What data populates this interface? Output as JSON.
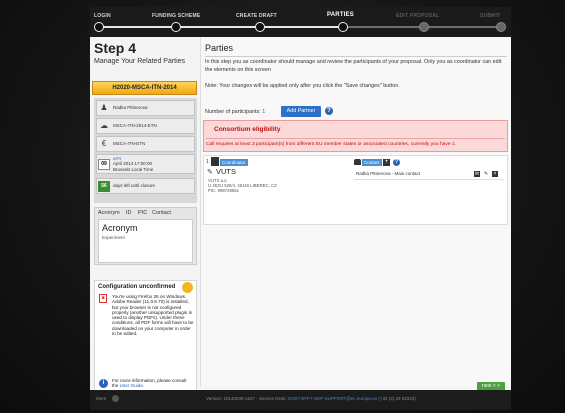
{
  "wizard": {
    "steps": [
      {
        "label": "LOGIN",
        "state": "done"
      },
      {
        "label": "FUNDING SCHEME",
        "state": "done"
      },
      {
        "label": "CREATE DRAFT",
        "state": "done"
      },
      {
        "label": "PARTIES",
        "state": "current"
      },
      {
        "label": "EDIT PROPOSAL",
        "state": "pending"
      },
      {
        "label": "SUBMIT",
        "state": "pending"
      }
    ]
  },
  "sidebar": {
    "step_title": "Step 4",
    "step_subtitle": "Manage Your Related Parties",
    "proposal_bar": "H2020-MSCA-ITN-2014",
    "info_items": [
      {
        "icon": "user-icon",
        "text": "Radka Pittnerova"
      },
      {
        "icon": "cloud-icon",
        "text": "MSCA-ITN-2014-ETN"
      },
      {
        "icon": "euro-icon",
        "text": "MSCA-ITN-ETN"
      }
    ],
    "deadline_month": "APR",
    "deadline_day": "09",
    "deadline_line1": "April 2014 17:00:00",
    "deadline_line2": "Brussels Local Time",
    "days_left": "56",
    "days_left_text": "days left until closure",
    "tabs": [
      "Acronym",
      "ID",
      "PIC",
      "Contact"
    ],
    "acronym_value": "Acronym",
    "acronym_note": "Experiment",
    "config_title": "Configuration unconfirmed",
    "config_text": "You're using Firefox 26 on Windows. Adobe Reader (11.0.6.70) is installed, but your browser is not configured properly (another unsupported plugin is used to display PDFs). Under these conditions, all PDF forms will have to be downloaded on your computer in order to be edited.",
    "more_info_text": "For more information, please consult the",
    "more_info_link": "User Guide."
  },
  "main": {
    "page_title": "Parties",
    "description": "In this step you as coordinator should manage and review the participants of your proposal. Only you as coordinator can edit the elements on this screen",
    "note": "Note: Your changes will be applied only after you click the \"Save changes\" button.",
    "participants_label": "Number of participants:",
    "participants_count": "1",
    "add_partner_label": "Add Partner",
    "eligibility": {
      "title": "Consortium eligibility",
      "text": "Call requires at least 3 participant(s) from different EU member states or associated countries, currently you have 1."
    },
    "partner": {
      "index": "1",
      "role": "Coordinator",
      "name": "VUTS",
      "detail_1": "VUTS a.s.",
      "detail_2": "U JEZU 525/4, 46119 LIBEREC, CZ",
      "detail_3": "PIC: 998729551",
      "contact_label": "Contact",
      "contact_person": "Radka Pittnerova - Main contact"
    }
  },
  "next_label": "next > >",
  "footer": {
    "left": "More",
    "version_prefix": "Version: 20140206-1527 - Service Desk:",
    "service_desk": "DIGIT-EFP7-SEP-SUPPORT@ec.europa.eu",
    "phone": "(+32 (2) 29 92222)"
  },
  "colors": {
    "accent": "#2f6fc7",
    "proposal_bar": "#f0a811",
    "eligibility_bg": "#fbd9d9",
    "next_button": "#49a23c"
  }
}
